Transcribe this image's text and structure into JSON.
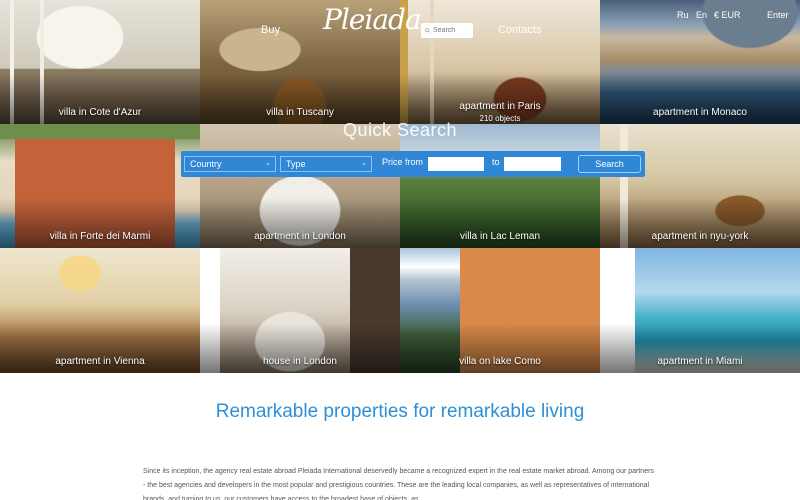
{
  "header": {
    "logo": "Pleiada",
    "nav": {
      "buy": "Buy",
      "contacts": "Contacts"
    },
    "search_placeholder": "Search",
    "languages": [
      "Ru",
      "En"
    ],
    "currency": "€ EUR",
    "enter": "Enter"
  },
  "tiles": [
    {
      "caption": "villa in Cote d'Azur",
      "sub": ""
    },
    {
      "caption": "villa in Tuscany",
      "sub": ""
    },
    {
      "caption": "apartment in Paris",
      "sub": "210 objects"
    },
    {
      "caption": "apartment in Monaco",
      "sub": ""
    },
    {
      "caption": "villa in Forte dei Marmi",
      "sub": ""
    },
    {
      "caption": "apartment in London",
      "sub": ""
    },
    {
      "caption": "villa in Lac Leman",
      "sub": ""
    },
    {
      "caption": "apartment in nyu-york",
      "sub": ""
    },
    {
      "caption": "apartment in Vienna",
      "sub": ""
    },
    {
      "caption": "house in London",
      "sub": ""
    },
    {
      "caption": "villa on lake Como",
      "sub": ""
    },
    {
      "caption": "apartment in Miami",
      "sub": ""
    }
  ],
  "quick_search": {
    "title": "Quick Search",
    "country": "Country",
    "type": "Type",
    "price_from": "Price from",
    "to": "to",
    "button": "Search"
  },
  "intro": {
    "title": "Remarkable properties for remarkable living",
    "text": "Since its inception, the agency real estate abroad Pleiada International deservedly became a recognized expert in the real estate market abroad. Among our partners - the best agencies and developers in the most popular and prestigious countries. These are the leading local companies, as well as representatives of international brands, and turning to us, our customers have access to the broadest base of objects, as"
  },
  "colors": {
    "accent": "#2f87d6",
    "title_blue": "#2f8fd6"
  }
}
